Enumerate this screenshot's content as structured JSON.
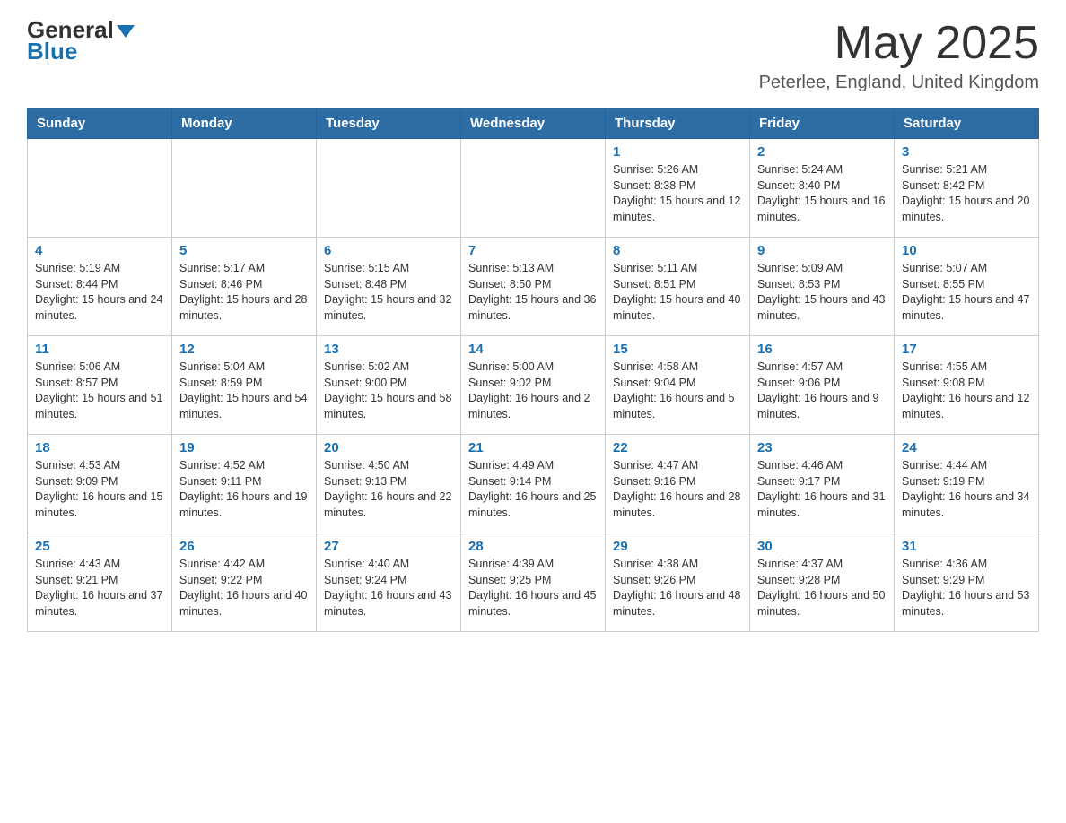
{
  "header": {
    "logo_general": "General",
    "logo_blue": "Blue",
    "month_title": "May 2025",
    "location": "Peterlee, England, United Kingdom"
  },
  "weekdays": [
    "Sunday",
    "Monday",
    "Tuesday",
    "Wednesday",
    "Thursday",
    "Friday",
    "Saturday"
  ],
  "weeks": [
    [
      {
        "day": "",
        "info": ""
      },
      {
        "day": "",
        "info": ""
      },
      {
        "day": "",
        "info": ""
      },
      {
        "day": "",
        "info": ""
      },
      {
        "day": "1",
        "info": "Sunrise: 5:26 AM\nSunset: 8:38 PM\nDaylight: 15 hours and 12 minutes."
      },
      {
        "day": "2",
        "info": "Sunrise: 5:24 AM\nSunset: 8:40 PM\nDaylight: 15 hours and 16 minutes."
      },
      {
        "day": "3",
        "info": "Sunrise: 5:21 AM\nSunset: 8:42 PM\nDaylight: 15 hours and 20 minutes."
      }
    ],
    [
      {
        "day": "4",
        "info": "Sunrise: 5:19 AM\nSunset: 8:44 PM\nDaylight: 15 hours and 24 minutes."
      },
      {
        "day": "5",
        "info": "Sunrise: 5:17 AM\nSunset: 8:46 PM\nDaylight: 15 hours and 28 minutes."
      },
      {
        "day": "6",
        "info": "Sunrise: 5:15 AM\nSunset: 8:48 PM\nDaylight: 15 hours and 32 minutes."
      },
      {
        "day": "7",
        "info": "Sunrise: 5:13 AM\nSunset: 8:50 PM\nDaylight: 15 hours and 36 minutes."
      },
      {
        "day": "8",
        "info": "Sunrise: 5:11 AM\nSunset: 8:51 PM\nDaylight: 15 hours and 40 minutes."
      },
      {
        "day": "9",
        "info": "Sunrise: 5:09 AM\nSunset: 8:53 PM\nDaylight: 15 hours and 43 minutes."
      },
      {
        "day": "10",
        "info": "Sunrise: 5:07 AM\nSunset: 8:55 PM\nDaylight: 15 hours and 47 minutes."
      }
    ],
    [
      {
        "day": "11",
        "info": "Sunrise: 5:06 AM\nSunset: 8:57 PM\nDaylight: 15 hours and 51 minutes."
      },
      {
        "day": "12",
        "info": "Sunrise: 5:04 AM\nSunset: 8:59 PM\nDaylight: 15 hours and 54 minutes."
      },
      {
        "day": "13",
        "info": "Sunrise: 5:02 AM\nSunset: 9:00 PM\nDaylight: 15 hours and 58 minutes."
      },
      {
        "day": "14",
        "info": "Sunrise: 5:00 AM\nSunset: 9:02 PM\nDaylight: 16 hours and 2 minutes."
      },
      {
        "day": "15",
        "info": "Sunrise: 4:58 AM\nSunset: 9:04 PM\nDaylight: 16 hours and 5 minutes."
      },
      {
        "day": "16",
        "info": "Sunrise: 4:57 AM\nSunset: 9:06 PM\nDaylight: 16 hours and 9 minutes."
      },
      {
        "day": "17",
        "info": "Sunrise: 4:55 AM\nSunset: 9:08 PM\nDaylight: 16 hours and 12 minutes."
      }
    ],
    [
      {
        "day": "18",
        "info": "Sunrise: 4:53 AM\nSunset: 9:09 PM\nDaylight: 16 hours and 15 minutes."
      },
      {
        "day": "19",
        "info": "Sunrise: 4:52 AM\nSunset: 9:11 PM\nDaylight: 16 hours and 19 minutes."
      },
      {
        "day": "20",
        "info": "Sunrise: 4:50 AM\nSunset: 9:13 PM\nDaylight: 16 hours and 22 minutes."
      },
      {
        "day": "21",
        "info": "Sunrise: 4:49 AM\nSunset: 9:14 PM\nDaylight: 16 hours and 25 minutes."
      },
      {
        "day": "22",
        "info": "Sunrise: 4:47 AM\nSunset: 9:16 PM\nDaylight: 16 hours and 28 minutes."
      },
      {
        "day": "23",
        "info": "Sunrise: 4:46 AM\nSunset: 9:17 PM\nDaylight: 16 hours and 31 minutes."
      },
      {
        "day": "24",
        "info": "Sunrise: 4:44 AM\nSunset: 9:19 PM\nDaylight: 16 hours and 34 minutes."
      }
    ],
    [
      {
        "day": "25",
        "info": "Sunrise: 4:43 AM\nSunset: 9:21 PM\nDaylight: 16 hours and 37 minutes."
      },
      {
        "day": "26",
        "info": "Sunrise: 4:42 AM\nSunset: 9:22 PM\nDaylight: 16 hours and 40 minutes."
      },
      {
        "day": "27",
        "info": "Sunrise: 4:40 AM\nSunset: 9:24 PM\nDaylight: 16 hours and 43 minutes."
      },
      {
        "day": "28",
        "info": "Sunrise: 4:39 AM\nSunset: 9:25 PM\nDaylight: 16 hours and 45 minutes."
      },
      {
        "day": "29",
        "info": "Sunrise: 4:38 AM\nSunset: 9:26 PM\nDaylight: 16 hours and 48 minutes."
      },
      {
        "day": "30",
        "info": "Sunrise: 4:37 AM\nSunset: 9:28 PM\nDaylight: 16 hours and 50 minutes."
      },
      {
        "day": "31",
        "info": "Sunrise: 4:36 AM\nSunset: 9:29 PM\nDaylight: 16 hours and 53 minutes."
      }
    ]
  ]
}
